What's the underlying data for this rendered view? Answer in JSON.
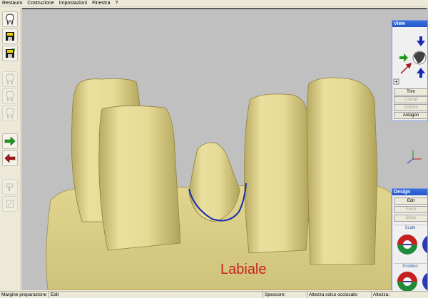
{
  "menu": {
    "items": [
      "Restauro",
      "Costruzione",
      "Impostazioni",
      "Finestra",
      "?"
    ]
  },
  "viewport": {
    "label": "Labiale",
    "background": "#c0c0c0",
    "model_color": "#e8dc9a",
    "margin_line_color": "#1a2ab0",
    "label_color": "#c8201c"
  },
  "view_panel": {
    "title": "View",
    "buttons": [
      {
        "label": "Trim",
        "enabled": true
      },
      {
        "label": "Contat",
        "enabled": false
      },
      {
        "label": "Dist/sin",
        "enabled": false
      },
      {
        "label": "Antagon",
        "enabled": true
      }
    ]
  },
  "design_panel": {
    "title": "Design",
    "buttons": [
      {
        "label": "Edit",
        "enabled": true
      },
      {
        "label": "Form",
        "enabled": false
      },
      {
        "label": "Disco",
        "enabled": false
      }
    ],
    "groups": [
      "Scale",
      "Position"
    ]
  },
  "status": {
    "mode": "Margine preparazione",
    "action": "Edit",
    "thickness": "Spessore:",
    "occlusal": "Altezza solco occlusale:",
    "height": "Altezza:"
  }
}
